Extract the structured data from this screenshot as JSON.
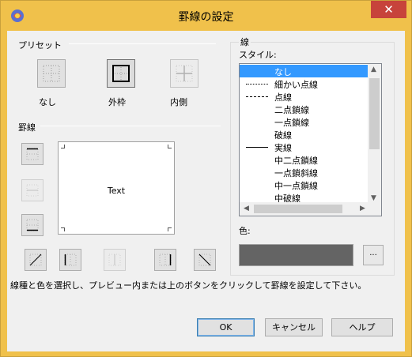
{
  "window": {
    "title": "罫線の設定",
    "close_symbol": "✕",
    "frame_color": "#f0c14b",
    "close_color": "#c7433b"
  },
  "preset": {
    "section_label": "プリセット",
    "items": [
      {
        "label": "なし",
        "icon": "border-none-icon"
      },
      {
        "label": "外枠",
        "icon": "border-outline-icon"
      },
      {
        "label": "内側",
        "icon": "border-inside-icon"
      }
    ]
  },
  "border": {
    "section_label": "罫線",
    "preview_text": "Text"
  },
  "line": {
    "group_label": "線",
    "style_label": "スタイル:",
    "styles": [
      {
        "label": "なし",
        "selected": true
      },
      {
        "label": "細かい点線"
      },
      {
        "label": "点線"
      },
      {
        "label": "二点鎖線"
      },
      {
        "label": "一点鎖線"
      },
      {
        "label": "破線"
      },
      {
        "label": "実線"
      },
      {
        "label": "中二点鎖線"
      },
      {
        "label": "一点鎖斜線"
      },
      {
        "label": "中一点鎖線"
      },
      {
        "label": "中破線"
      }
    ],
    "color_label": "色:",
    "color_value": "#646464",
    "color_button_label": "..."
  },
  "hint": "線種と色を選択し、プレビュー内または上のボタンをクリックして罫線を設定して下さい。",
  "buttons": {
    "ok": "OK",
    "cancel": "キャンセル",
    "help": "ヘルプ"
  }
}
